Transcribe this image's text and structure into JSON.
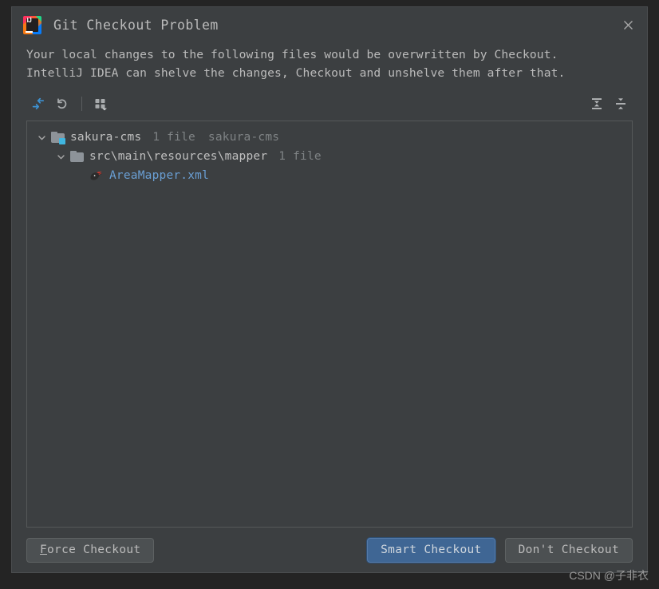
{
  "window": {
    "title": "Git Checkout Problem",
    "app_icon": "intellij-idea-icon",
    "close_icon": "close-icon",
    "logo_text": "IJ"
  },
  "message": {
    "line1": "Your local changes to the following files would be overwritten by Checkout.",
    "line2": "IntelliJ IDEA can shelve the changes, Checkout and unshelve them after that."
  },
  "toolbar": {
    "left_items": [
      {
        "name": "shelve-changes-icon",
        "tooltip": "Shelve Silently"
      },
      {
        "name": "revert-icon",
        "tooltip": "Revert"
      },
      {
        "name": "group-by-icon",
        "tooltip": "Group By"
      }
    ],
    "right_items": [
      {
        "name": "expand-all-icon",
        "tooltip": "Expand All"
      },
      {
        "name": "collapse-all-icon",
        "tooltip": "Collapse All"
      }
    ]
  },
  "tree": {
    "nodes": [
      {
        "icon": "folder-module-icon",
        "chevron": "chevron-down-icon",
        "label": "sakura-cms",
        "count": "1 file",
        "hint": "sakura-cms",
        "kind": "module"
      },
      {
        "icon": "folder-icon",
        "chevron": "chevron-down-icon",
        "label": "src\\main\\resources\\mapper",
        "count": "1 file",
        "hint": "",
        "kind": "directory"
      },
      {
        "icon": "mybatis-file-icon",
        "chevron": "",
        "label": "AreaMapper.xml",
        "count": "",
        "hint": "",
        "kind": "file"
      }
    ]
  },
  "footer": {
    "force_checkout": "Force Checkout",
    "force_checkout_mnemonic": "F",
    "force_checkout_rest": "orce Checkout",
    "smart_checkout": "Smart Checkout",
    "dont_checkout": "Don't Checkout"
  },
  "watermark": "CSDN @子非衣",
  "colors": {
    "backdrop": "#242424",
    "dialog_bg": "#3c3f41",
    "text": "#bbbbbb",
    "muted_text": "#7f8385",
    "file_link": "#6a9fd4",
    "accent_blue": "#3f6694",
    "icon_blue": "#3d91d1",
    "folder_gray": "#8d9399",
    "badge_cyan": "#40b6e0"
  }
}
